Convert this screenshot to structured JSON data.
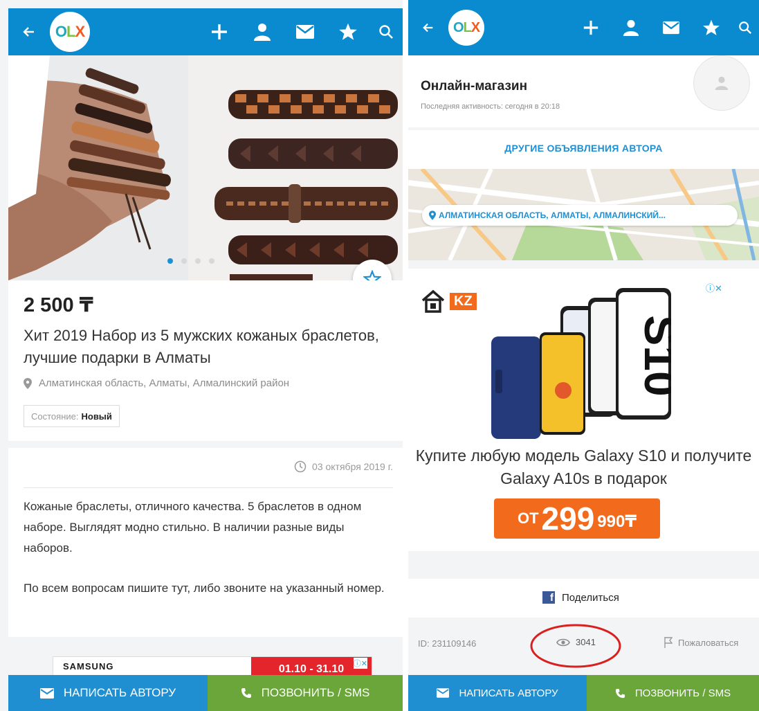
{
  "app": {
    "logo_text": "OLX"
  },
  "left": {
    "carousel": {
      "dots_total": 4,
      "active_dot": 0
    },
    "price": "2 500 ₸",
    "title": "Хит 2019 Набор из 5 мужских кожаных браслетов, лучшие подарки в Алматы",
    "location": "Алматинская область, Алматы, Алмалинский район",
    "condition_label": "Состояние:",
    "condition_value": "Новый",
    "date": "03 октября 2019 г.",
    "description_p1": "Кожаные браслеты, отличного качества. 5 браслетов в одном наборе. Выглядят модно стильно. В наличии разные виды наборов.",
    "description_p2": "По всем вопросам пишите тут, либо звоните на указанный номер.",
    "ad_banner": {
      "brand": "SAMSUNG",
      "dates": "01.10 - 31.10"
    }
  },
  "right": {
    "seller_name": "Онлайн-магазин",
    "last_activity": "Последняя активность: сегодня в 20:18",
    "other_ads_link": "ДРУГИЕ ОБЪЯВЛЕНИЯ АВТОРА",
    "map_location": "АЛМАТИНСКАЯ ОБЛАСТЬ, АЛМАТЫ, АЛМАЛИНСКИЙ...",
    "ad": {
      "brand": "KZ",
      "phone_text": "S10",
      "headline": "Купите любую модель Galaxy S10 и получите Galaxy A10s в подарок",
      "price_prefix": "ОТ",
      "price_main": "299",
      "price_suffix": "990₸"
    },
    "share_label": "Поделиться",
    "ad_id": "ID: 231109146",
    "views": "3041",
    "report_label": "Пожаловаться"
  },
  "actions": {
    "write_author": "НАПИСАТЬ АВТОРУ",
    "call_sms": "ПОЗВОНИТЬ / SMS"
  },
  "colors": {
    "topbar": "#0a8bd0",
    "link_blue": "#1f8fd2",
    "call_green": "#6aa63a",
    "price_orange": "#f26b1d",
    "highlight_circle": "#d9201f"
  }
}
